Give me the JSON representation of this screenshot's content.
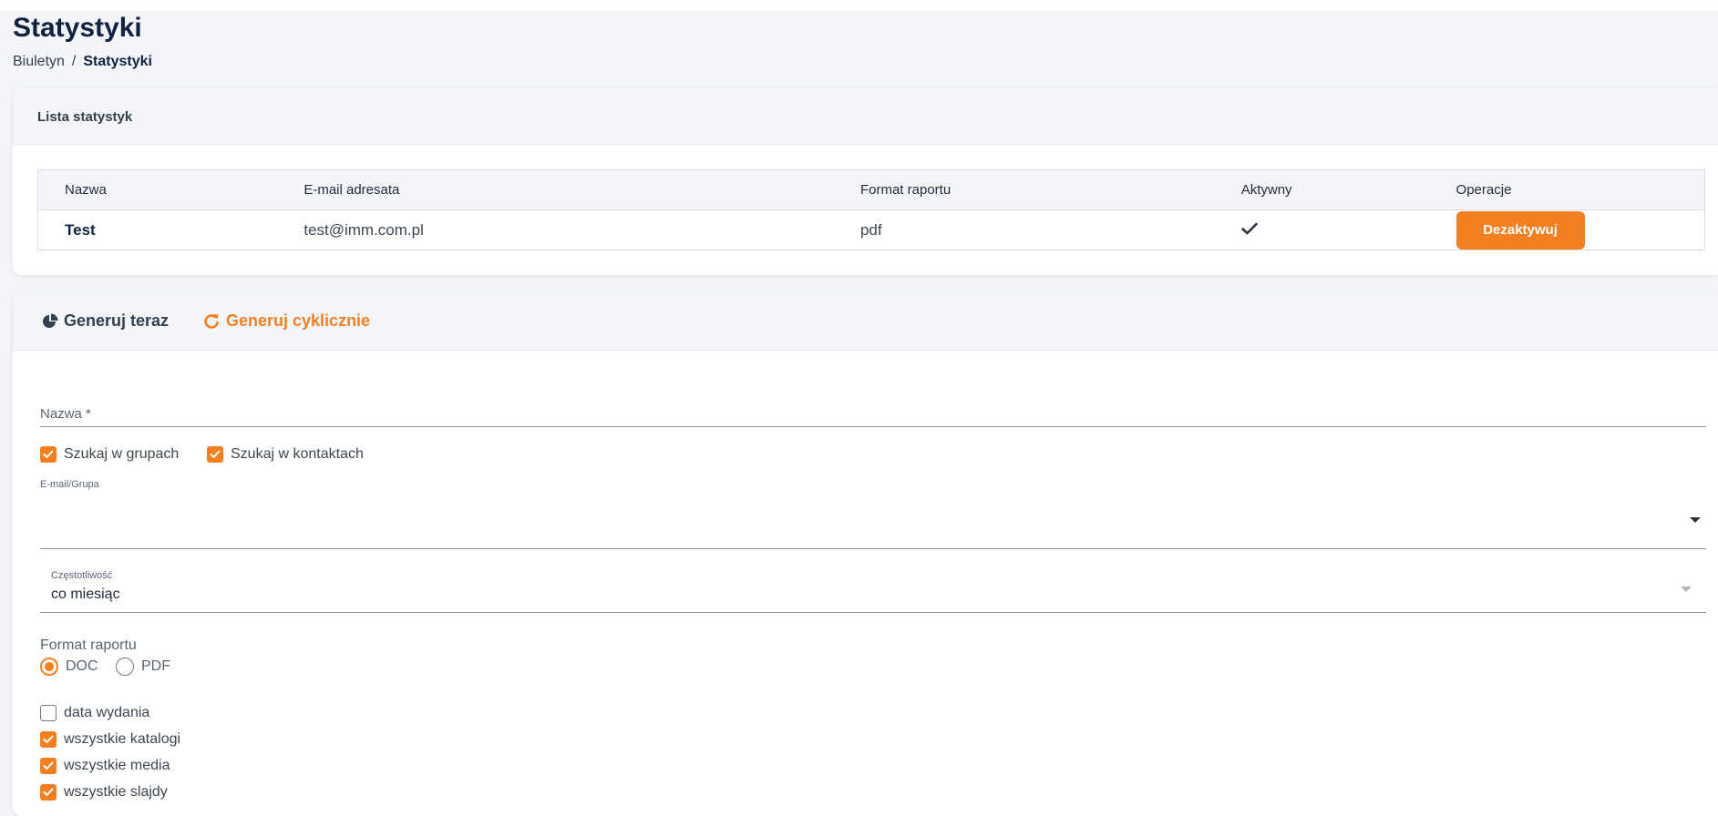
{
  "header": {
    "title": "Statystyki",
    "breadcrumb": {
      "parent": "Biuletyn",
      "separator": "/",
      "current": "Statystyki"
    }
  },
  "stats_list": {
    "title": "Lista statystyk",
    "columns": [
      "Nazwa",
      "E-mail adresata",
      "Format raportu",
      "Aktywny",
      "Operacje"
    ],
    "rows": [
      {
        "name": "Test",
        "email": "test@imm.com.pl",
        "format": "pdf",
        "active": true,
        "action_label": "Dezaktywuj"
      }
    ]
  },
  "generator": {
    "tabs": [
      {
        "label": "Generuj teraz",
        "icon": "pie-chart-icon",
        "active": false
      },
      {
        "label": "Generuj cyklicznie",
        "icon": "redo-icon",
        "active": true
      }
    ],
    "name_field": {
      "label": "Nazwa *",
      "value": ""
    },
    "search_options": [
      {
        "label": "Szukaj w grupach",
        "checked": true
      },
      {
        "label": "Szukaj w kontaktach",
        "checked": true
      }
    ],
    "recipient_field": {
      "label": "E-mail/Grupa",
      "value": ""
    },
    "frequency_field": {
      "label": "Częstotliwość",
      "value": "co miesiąc"
    },
    "report_format": {
      "label": "Format raportu",
      "options": [
        {
          "label": "DOC",
          "selected": true
        },
        {
          "label": "PDF",
          "selected": false
        }
      ]
    },
    "content_options": [
      {
        "label": "data wydania",
        "checked": false
      },
      {
        "label": "wszystkie katalogi",
        "checked": true
      },
      {
        "label": "wszystkie media",
        "checked": true
      },
      {
        "label": "wszystkie slajdy",
        "checked": true
      }
    ]
  },
  "colors": {
    "accent": "#f47f20",
    "title": "#0f2340",
    "background": "#f3f5f8"
  }
}
